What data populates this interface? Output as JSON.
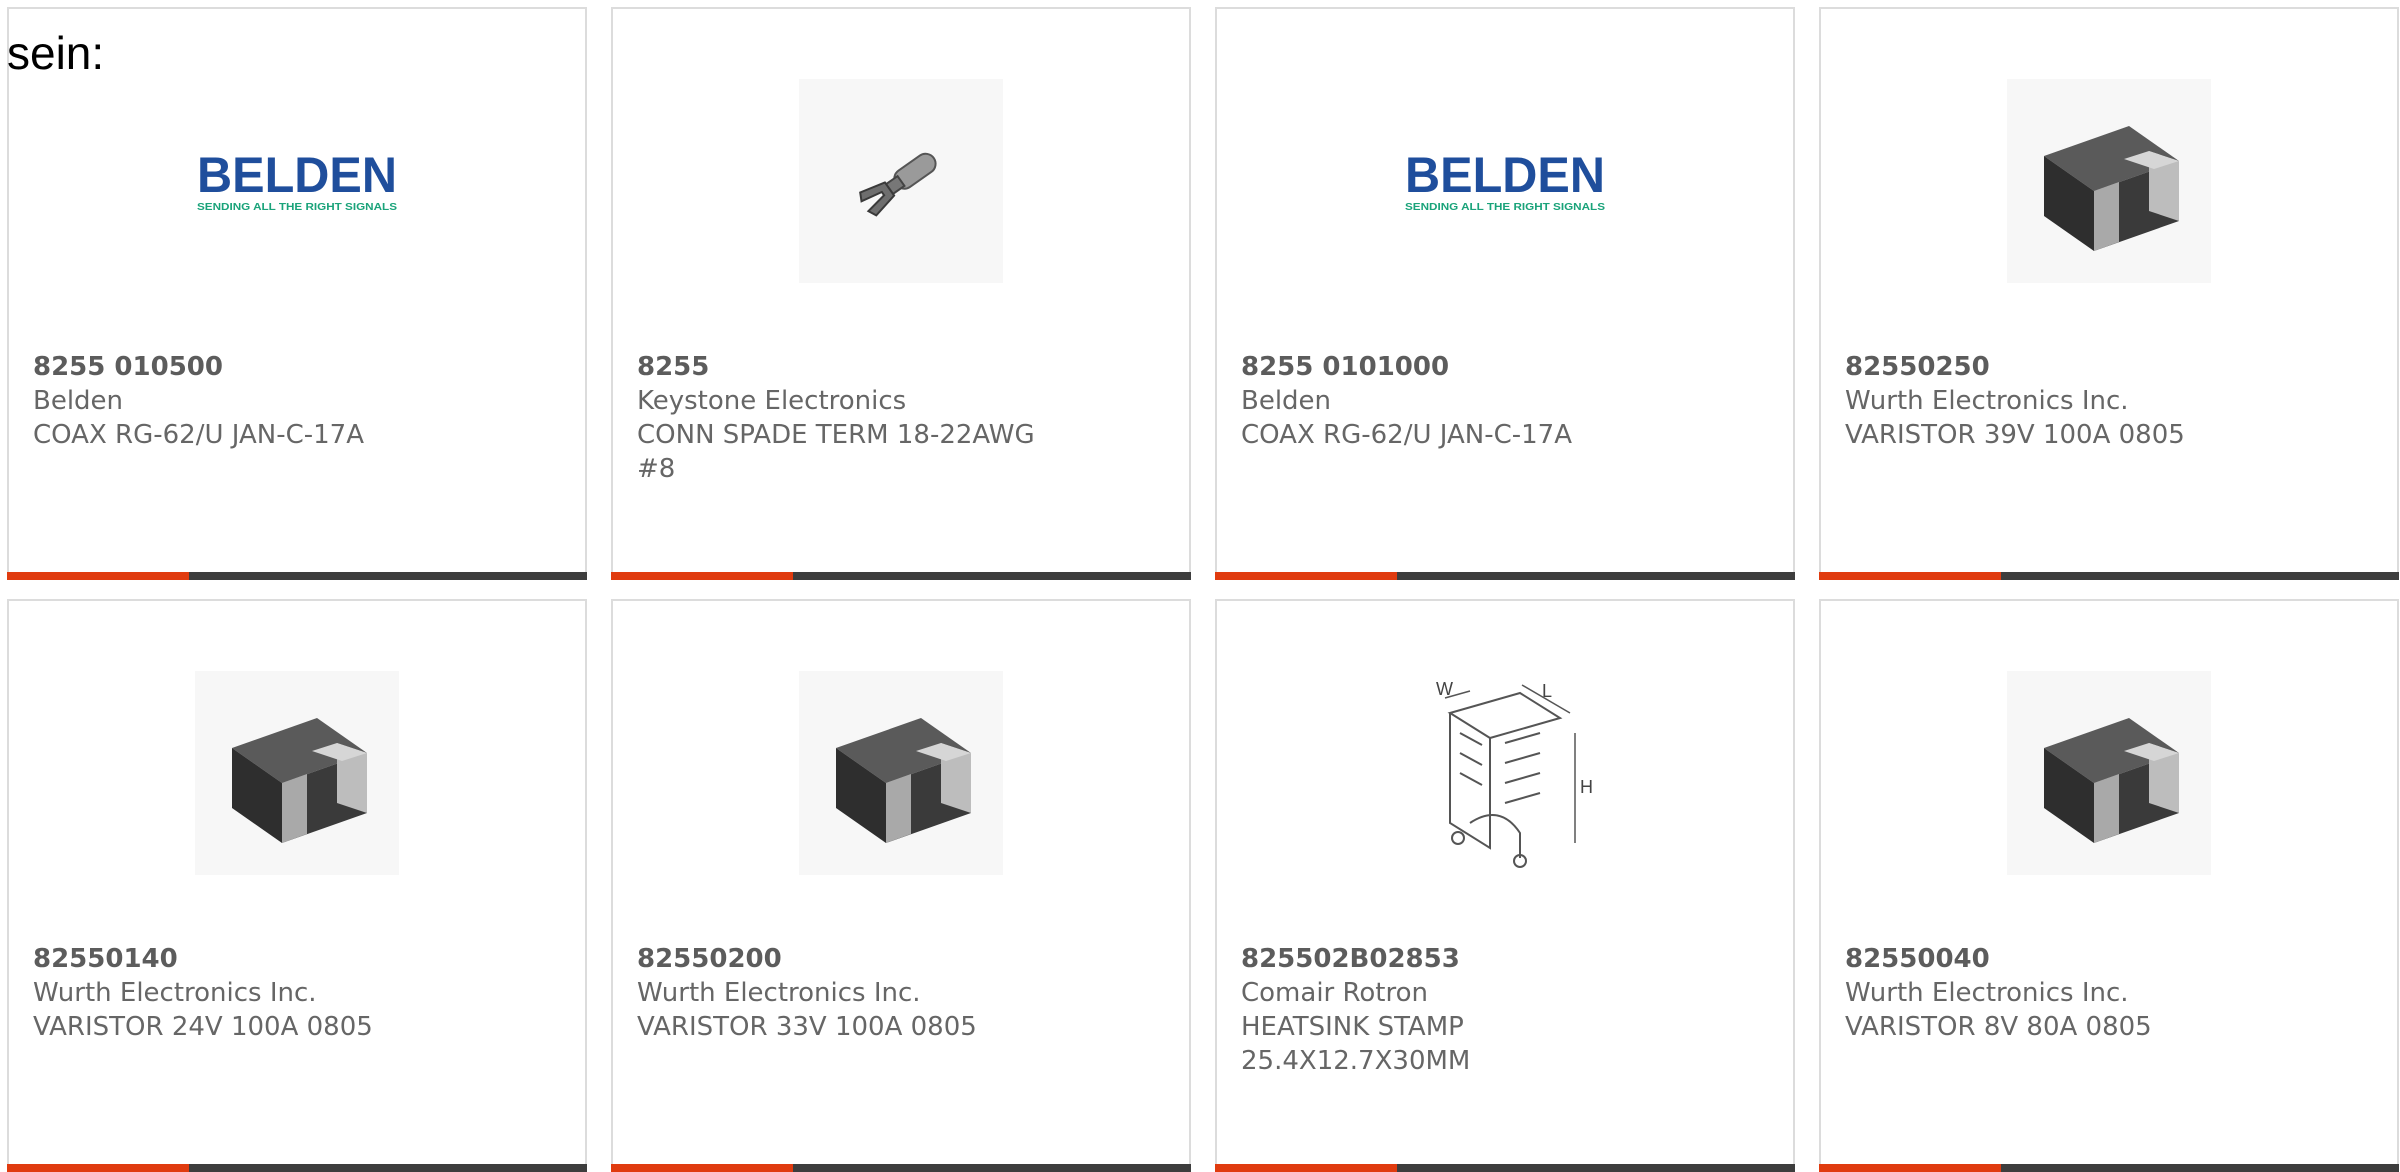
{
  "heading": "sein:",
  "colors": {
    "accent": "#e03b0f",
    "bar": "#3d3d3d",
    "text": "#666666",
    "belden_blue": "#1f4e9c",
    "belden_green": "#1aa37a"
  },
  "products": [
    {
      "part": "8255 010500",
      "maker": "Belden",
      "desc": "COAX RG-62/U JAN-C-17A",
      "image": "belden-logo"
    },
    {
      "part": "8255",
      "maker": "Keystone Electronics",
      "desc": "CONN SPADE TERM 18-22AWG #8",
      "image": "spade-terminal"
    },
    {
      "part": "8255 0101000",
      "maker": "Belden",
      "desc": "COAX RG-62/U JAN-C-17A",
      "image": "belden-logo"
    },
    {
      "part": "82550250",
      "maker": "Wurth Electronics Inc.",
      "desc": "VARISTOR 39V 100A 0805",
      "image": "smd-chip"
    },
    {
      "part": "82550140",
      "maker": "Wurth Electronics Inc.",
      "desc": "VARISTOR 24V 100A 0805",
      "image": "smd-chip"
    },
    {
      "part": "82550200",
      "maker": "Wurth Electronics Inc.",
      "desc": "VARISTOR 33V 100A 0805",
      "image": "smd-chip"
    },
    {
      "part": "825502B02853",
      "maker": "Comair Rotron",
      "desc": "HEATSINK STAMP 25.4X12.7X30MM",
      "image": "heatsink-drawing"
    },
    {
      "part": "82550040",
      "maker": "Wurth Electronics Inc.",
      "desc": "VARISTOR 8V 80A 0805",
      "image": "smd-chip"
    }
  ],
  "logo": {
    "brand": "BELDEN",
    "tagline": "SENDING ALL THE RIGHT SIGNALS"
  },
  "diagram_labels": {
    "w": "W",
    "l": "L",
    "h": "H"
  }
}
